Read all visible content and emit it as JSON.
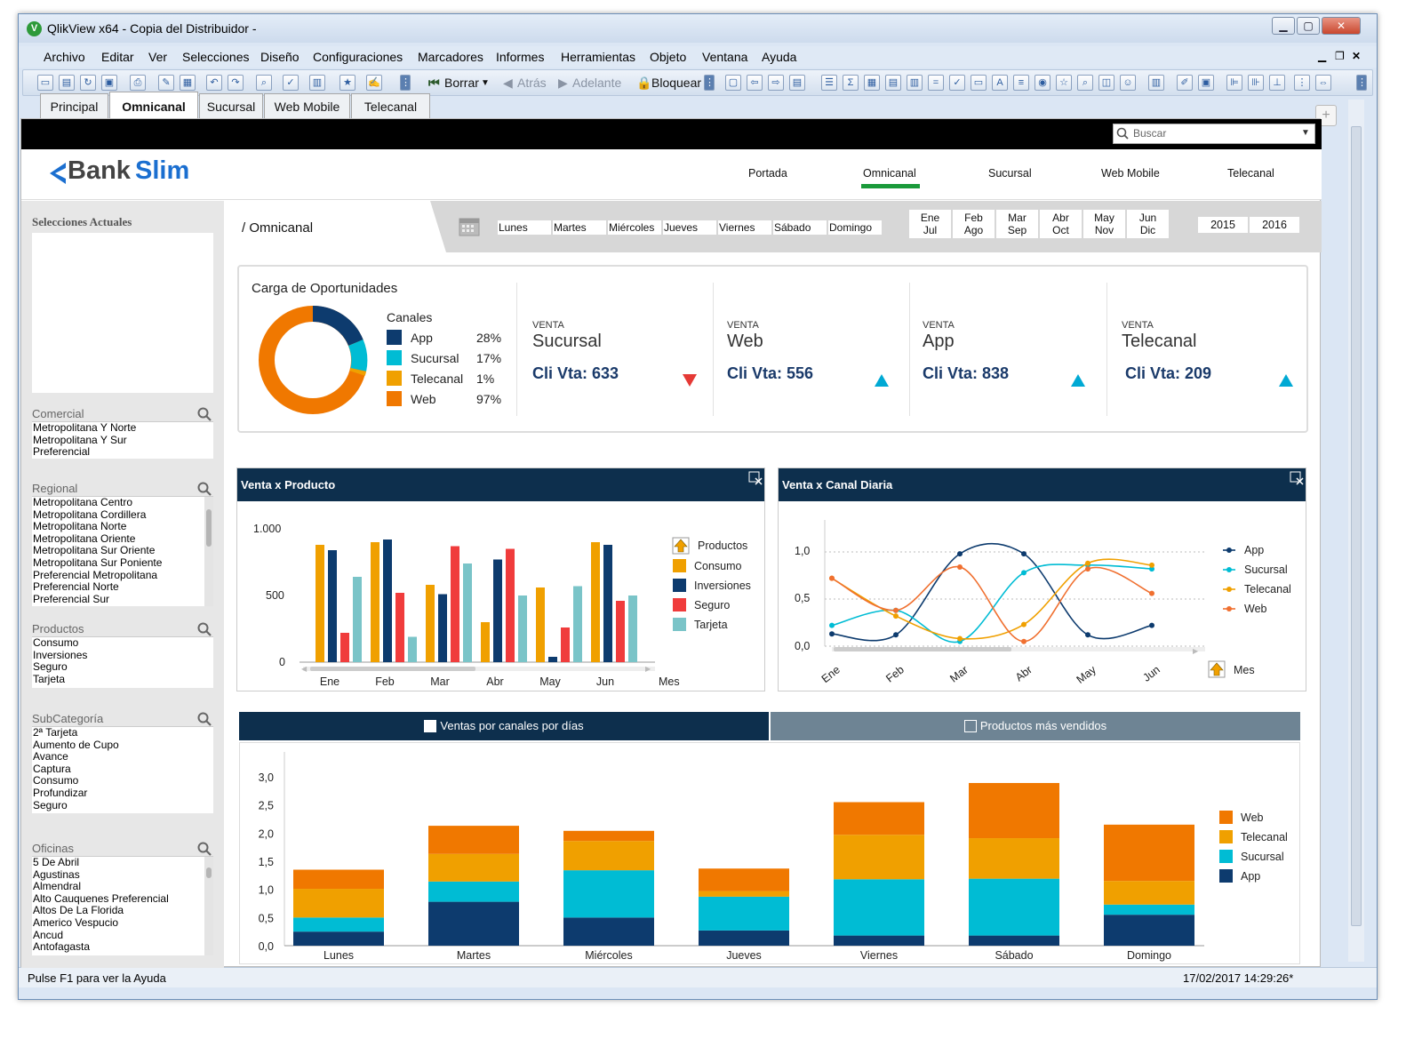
{
  "window": {
    "title": "QlikView x64 - Copia del Distribuidor -",
    "app_icon": "V",
    "controls": {
      "minimize": "▁",
      "maximize": "▢",
      "close": "✕"
    }
  },
  "menu": [
    "Archivo",
    "Editar",
    "Ver",
    "Selecciones",
    "Diseño",
    "Configuraciones",
    "Marcadores",
    "Informes",
    "Herramientas",
    "Objeto",
    "Ventana",
    "Ayuda"
  ],
  "toolbar": {
    "borrar": "Borrar",
    "atras": "Atrás",
    "adelante": "Adelante",
    "bloquear": "Bloquear"
  },
  "sheet_tabs": [
    "Principal",
    "Omnicanal",
    "Sucursal",
    "Web Mobile",
    "Telecanal"
  ],
  "active_tab": "Omnicanal",
  "search": {
    "placeholder": "Buscar"
  },
  "brand": {
    "name_part1": "Bank",
    "name_part2": "Slim",
    "color": "#1b6fd0"
  },
  "top_nav": {
    "items": [
      "Portada",
      "Omnicanal",
      "Sucursal",
      "Web Mobile",
      "Telecanal"
    ],
    "active": "Omnicanal"
  },
  "breadcrumb": "/ Omnicanal",
  "weekdays": [
    "Lunes",
    "Martes",
    "Miércoles",
    "Jueves",
    "Viernes",
    "Sábado",
    "Domingo"
  ],
  "bimesters": [
    [
      "Ene",
      "Jul"
    ],
    [
      "Feb",
      "Ago"
    ],
    [
      "Mar",
      "Sep"
    ],
    [
      "Abr",
      "Oct"
    ],
    [
      "May",
      "Nov"
    ],
    [
      "Jun",
      "Dic"
    ]
  ],
  "years": [
    "2015",
    "2016"
  ],
  "left_panel": {
    "current_selections": "Selecciones Actuales",
    "listboxes": [
      {
        "title": "Comercial",
        "items": [
          "Metropolitana Y Norte",
          "Metropolitana Y Sur",
          "Preferencial"
        ]
      },
      {
        "title": "Regional",
        "items": [
          "Metropolitana Centro",
          "Metropolitana Cordillera",
          "Metropolitana Norte",
          "Metropolitana Oriente",
          "Metropolitana Sur Oriente",
          "Metropolitana Sur Poniente",
          "Preferencial Metropolitana",
          "Preferencial Norte",
          "Preferencial Sur"
        ]
      },
      {
        "title": "Productos",
        "items": [
          "Consumo",
          "Inversiones",
          "Seguro",
          "Tarjeta"
        ]
      },
      {
        "title": "SubCategoría",
        "items": [
          "2ª Tarjeta",
          "Aumento de Cupo",
          "Avance",
          "Captura",
          "Consumo",
          "Profundizar",
          "Seguro"
        ]
      },
      {
        "title": "Oficinas",
        "items": [
          "5 De Abril",
          "Agustinas",
          "Almendral",
          "Alto Cauquenes Preferencial",
          "Altos De La Florida",
          "Americo Vespucio",
          "Ancud",
          "Antofagasta"
        ]
      }
    ]
  },
  "oportunidades": {
    "title": "Carga de Oportunidades",
    "legend_title": "Canales",
    "channels": [
      {
        "name": "App",
        "pct": "28%",
        "color": "#0d3b6e"
      },
      {
        "name": "Sucursal",
        "pct": "17%",
        "color": "#00bcd4"
      },
      {
        "name": "Telecanal",
        "pct": "1%",
        "color": "#f0a000"
      },
      {
        "name": "Web",
        "pct": "97%",
        "color": "#f07800"
      }
    ]
  },
  "kpis": [
    {
      "label": "VENTA",
      "name": "Sucursal",
      "value": "Cli Vta: 633",
      "trend": "down",
      "trend_color": "#e53935"
    },
    {
      "label": "VENTA",
      "name": "Web",
      "value": "Cli Vta: 556",
      "trend": "up",
      "trend_color": "#00a9d4"
    },
    {
      "label": "VENTA",
      "name": "App",
      "value": "Cli Vta: 838",
      "trend": "up",
      "trend_color": "#00a9d4"
    },
    {
      "label": "VENTA",
      "name": "Telecanal",
      "value": "Cli Vta: 209",
      "trend": "up",
      "trend_color": "#00a9d4"
    }
  ],
  "panels": {
    "venta_producto": "Venta x Producto",
    "venta_canal": "Venta x Canal Diaria",
    "tab_ventas": "Ventas por canales por días",
    "tab_productos": "Productos más vendidos",
    "productos_label": "Productos",
    "mes_label": "Mes"
  },
  "status": {
    "help": "Pulse F1 para ver la Ayuda",
    "datetime": "17/02/2017 14:29:26*"
  },
  "chart_data": [
    {
      "type": "bar",
      "title": "Venta x Producto",
      "categories": [
        "Ene",
        "Feb",
        "Mar",
        "Abr",
        "May",
        "Jun"
      ],
      "extra_tick": "Mes",
      "ylim": [
        0,
        1000
      ],
      "yticks": [
        "0",
        "500",
        "1.000"
      ],
      "series": [
        {
          "name": "Consumo",
          "color": "#f0a000",
          "values": [
            880,
            900,
            580,
            300,
            560,
            900
          ]
        },
        {
          "name": "Inversiones",
          "color": "#0d3b6e",
          "values": [
            840,
            920,
            510,
            770,
            40,
            880
          ]
        },
        {
          "name": "Seguro",
          "color": "#f03c3c",
          "values": [
            220,
            520,
            870,
            850,
            260,
            460
          ]
        },
        {
          "name": "Tarjeta",
          "color": "#7ac4c8",
          "values": [
            640,
            190,
            740,
            500,
            570,
            500
          ]
        }
      ]
    },
    {
      "type": "line",
      "title": "Venta x Canal Diaria",
      "categories": [
        "Ene",
        "Feb",
        "Mar",
        "Abr",
        "May",
        "Jun"
      ],
      "ylim": [
        0,
        1.1
      ],
      "yticks": [
        "0,0",
        "0,5",
        "1,0"
      ],
      "series": [
        {
          "name": "App",
          "color": "#0d3b6e",
          "values": [
            0.13,
            0.12,
            0.98,
            0.98,
            0.12,
            0.22
          ]
        },
        {
          "name": "Sucursal",
          "color": "#00bcd4",
          "values": [
            0.22,
            0.38,
            0.05,
            0.78,
            0.86,
            0.82
          ]
        },
        {
          "name": "Telecanal",
          "color": "#f0a000",
          "values": [
            0.72,
            0.32,
            0.08,
            0.23,
            0.88,
            0.86
          ]
        },
        {
          "name": "Web",
          "color": "#f07030",
          "values": [
            0.72,
            0.38,
            0.84,
            0.05,
            0.82,
            0.56
          ]
        }
      ]
    },
    {
      "type": "bar",
      "stacked": true,
      "categories": [
        "Lunes",
        "Martes",
        "Miércoles",
        "Jueves",
        "Viernes",
        "Sábado",
        "Domingo"
      ],
      "ylim": [
        0,
        3.2
      ],
      "yticks": [
        "0,0",
        "0,5",
        "1,0",
        "1,5",
        "2,0",
        "2,5",
        "3,0"
      ],
      "series": [
        {
          "name": "App",
          "color": "#0d3b6e",
          "values": [
            0.25,
            0.78,
            0.5,
            0.27,
            0.18,
            0.18,
            0.55
          ]
        },
        {
          "name": "Sucursal",
          "color": "#00bcd4",
          "values": [
            0.25,
            0.36,
            0.84,
            0.6,
            1.0,
            1.01,
            0.18
          ]
        },
        {
          "name": "Telecanal",
          "color": "#f0a000",
          "values": [
            0.51,
            0.49,
            0.52,
            0.1,
            0.79,
            0.72,
            0.42
          ]
        },
        {
          "name": "Web",
          "color": "#f07800",
          "values": [
            0.34,
            0.5,
            0.18,
            0.4,
            0.58,
            0.98,
            1.0
          ]
        }
      ]
    }
  ]
}
